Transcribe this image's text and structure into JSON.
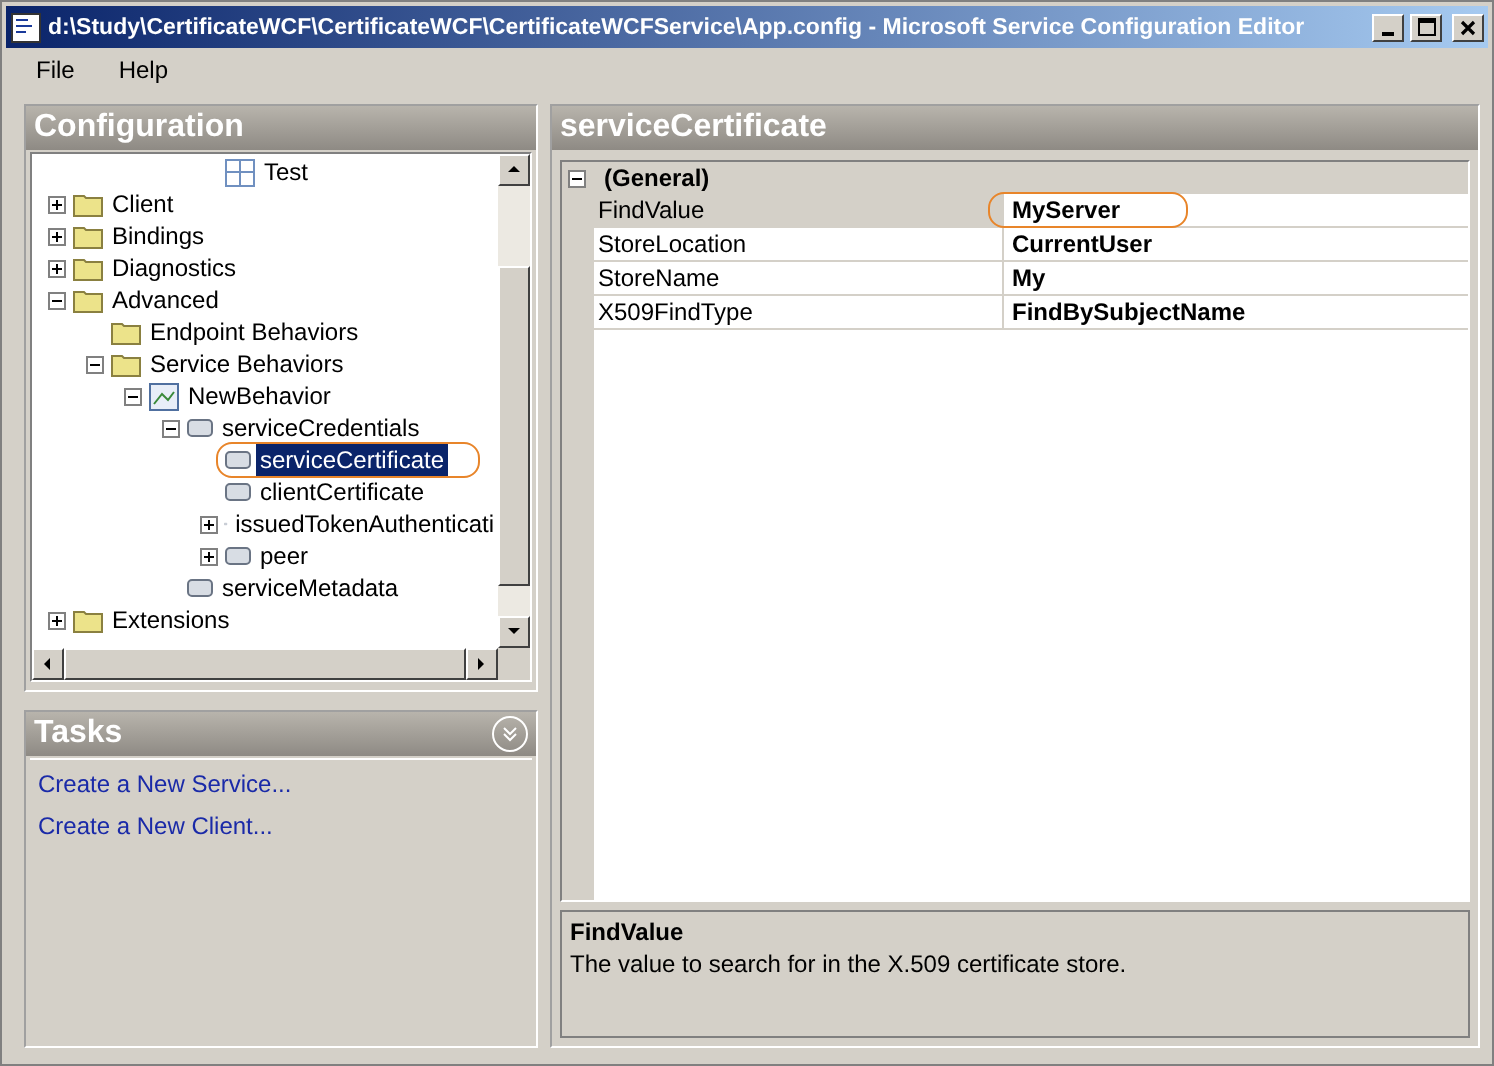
{
  "window": {
    "title": "d:\\Study\\CertificateWCF\\CertificateWCF\\CertificateWCFService\\App.config - Microsoft Service Configuration Editor"
  },
  "menu": [
    "File",
    "Help"
  ],
  "configuration": {
    "title": "Configuration",
    "tree": [
      {
        "label": "Test",
        "kind": "endpoint",
        "selected": false,
        "circled": false
      },
      {
        "label": "Client",
        "kind": "folder",
        "expanded": false,
        "selected": false,
        "circled": false
      },
      {
        "label": "Bindings",
        "kind": "folder",
        "expanded": false,
        "selected": false,
        "circled": false
      },
      {
        "label": "Diagnostics",
        "kind": "folder",
        "expanded": false,
        "selected": false,
        "circled": false
      },
      {
        "label": "Advanced",
        "kind": "folder",
        "expanded": true,
        "selected": false,
        "circled": false,
        "children": [
          {
            "label": "Endpoint Behaviors",
            "kind": "folder",
            "selected": false,
            "circled": false
          },
          {
            "label": "Service Behaviors",
            "kind": "folder",
            "expanded": true,
            "selected": false,
            "circled": false,
            "children": [
              {
                "label": "NewBehavior",
                "kind": "behavior",
                "expanded": true,
                "selected": false,
                "circled": false,
                "children": [
                  {
                    "label": "serviceCredentials",
                    "kind": "element",
                    "expanded": true,
                    "selected": false,
                    "circled": false,
                    "children": [
                      {
                        "label": "serviceCertificate",
                        "kind": "element",
                        "selected": true,
                        "circled": true
                      },
                      {
                        "label": "clientCertificate",
                        "kind": "element",
                        "selected": false,
                        "circled": false
                      },
                      {
                        "label": "issuedTokenAuthenticati",
                        "kind": "element",
                        "expanded": false,
                        "selected": false,
                        "circled": false
                      },
                      {
                        "label": "peer",
                        "kind": "element",
                        "expanded": false,
                        "selected": false,
                        "circled": false
                      }
                    ]
                  },
                  {
                    "label": "serviceMetadata",
                    "kind": "element",
                    "selected": false,
                    "circled": false
                  }
                ]
              }
            ]
          }
        ]
      },
      {
        "label": "Extensions",
        "kind": "folder",
        "expanded": false,
        "selected": false,
        "circled": false
      }
    ]
  },
  "tasks": {
    "title": "Tasks",
    "links": [
      "Create a New Service...",
      "Create a New Client..."
    ]
  },
  "properties": {
    "title": "serviceCertificate",
    "category": {
      "label": "(General)",
      "expanded": true
    },
    "rows": [
      {
        "name": "FindValue",
        "value": "MyServer",
        "selected": true,
        "circled": true
      },
      {
        "name": "StoreLocation",
        "value": "CurrentUser",
        "selected": false,
        "circled": false
      },
      {
        "name": "StoreName",
        "value": "My",
        "selected": false,
        "circled": false
      },
      {
        "name": "X509FindType",
        "value": "FindBySubjectName",
        "selected": false,
        "circled": false
      }
    ],
    "description": {
      "title": "FindValue",
      "text": "The value to search for in the X.509 certificate store."
    }
  }
}
